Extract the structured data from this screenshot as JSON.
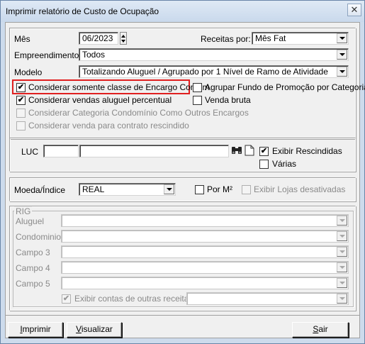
{
  "window": {
    "title": "Imprimir relatório de Custo de Ocupação",
    "close_label": "✕"
  },
  "filters": {
    "mes_label": "Mês",
    "mes_value": "06/2023",
    "receitas_label": "Receitas por:",
    "receitas_value": "Mês Fat",
    "empreendimento_label": "Empreendimento",
    "empreendimento_value": "Todos",
    "modelo_label": "Modelo",
    "modelo_value": "Totalizando Aluguel / Agrupado por 1 Nível de Ramo de Atividade"
  },
  "options": {
    "considerar_somente_classe": {
      "label": "Considerar somente classe de Encargo Comum",
      "checked": true
    },
    "agrupar_fundo": {
      "label": "Agrupar Fundo de Promoção por Categoria",
      "checked": false
    },
    "considerar_vendas_aluguel": {
      "label": "Considerar vendas aluguel percentual",
      "checked": true
    },
    "venda_bruta": {
      "label": "Venda bruta",
      "checked": false
    },
    "considerar_categoria_condominio": {
      "label": "Considerar Categoria Condomínio Como Outros Encargos",
      "checked": false
    },
    "considerar_venda_contrato": {
      "label": "Considerar venda para contrato rescindido",
      "checked": false
    }
  },
  "luc": {
    "label": "LUC",
    "code_value": "",
    "name_value": "",
    "exibir_rescindidas": {
      "label": "Exibir Rescindidas",
      "checked": true
    },
    "varias": {
      "label": "Várias",
      "checked": false
    }
  },
  "moeda": {
    "label": "Moeda/Índice",
    "value": "REAL",
    "por_m2": {
      "label": "Por M²",
      "checked": false
    },
    "exibir_lojas": {
      "label": "Exibir Lojas desativadas",
      "checked": false
    }
  },
  "rig": {
    "title": "RIG",
    "fields": [
      {
        "label": "Aluguel",
        "value": ""
      },
      {
        "label": "Condominio",
        "value": ""
      },
      {
        "label": "Campo 3",
        "value": ""
      },
      {
        "label": "Campo 4",
        "value": ""
      },
      {
        "label": "Campo 5",
        "value": ""
      }
    ],
    "exibir_contas": {
      "label": "Exibir contas de outras receitas",
      "checked": true,
      "value": ""
    }
  },
  "footer": {
    "imprimir": {
      "underline": "I",
      "rest": "mprimir"
    },
    "visualizar": {
      "underline": "V",
      "rest": "isualizar"
    },
    "sair": {
      "underline": "S",
      "rest": "air"
    }
  },
  "colors": {
    "highlight": "#e02020",
    "window_frame": "#cddbec"
  }
}
